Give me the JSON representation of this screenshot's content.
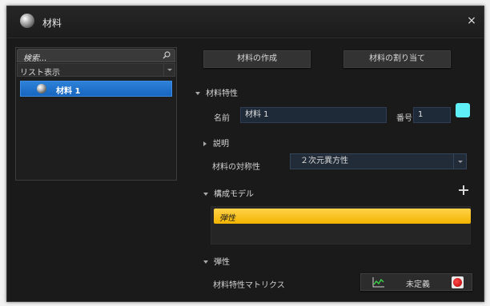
{
  "window": {
    "title": "材料",
    "close_glyph": "×"
  },
  "left_panel": {
    "search_placeholder": "検索...",
    "view_mode": "リスト表示",
    "materials": [
      {
        "label": "材料 1",
        "selected": true
      }
    ]
  },
  "actions": {
    "create_label": "材料の作成",
    "assign_label": "材料の割り当て"
  },
  "properties": {
    "section_label": "材料特性",
    "name_label": "名前",
    "name_value": "材料 1",
    "number_label": "番号",
    "number_value": "1",
    "color_swatch": "#5ff0f7",
    "description_label": "説明",
    "symmetry_label": "材料の対称性",
    "symmetry_value": "２次元異方性"
  },
  "constitutive": {
    "section_label": "構成モデル",
    "models": [
      {
        "label": "弾性",
        "selected": true,
        "highlight": "#ffc400"
      }
    ]
  },
  "elastic": {
    "section_label": "弾性",
    "matrix_label": "材料特性マトリクス",
    "matrix_status": "未定義",
    "status_color": "#d00000"
  },
  "icons": {
    "app": "material-sphere-icon",
    "search": "search-icon",
    "material_item": "material-sphere-icon",
    "add": "plus-icon",
    "matrix": "line-chart-icon",
    "status": "error-status-icon"
  }
}
